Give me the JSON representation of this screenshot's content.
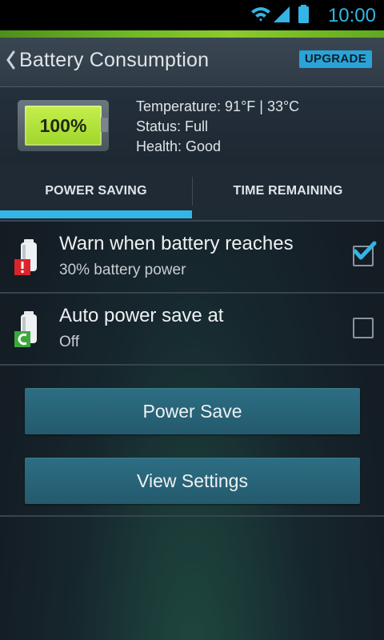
{
  "status_bar": {
    "time": "10:00",
    "icons": [
      "wifi-icon",
      "signal-icon",
      "battery-icon"
    ],
    "time_color": "#33b5e5"
  },
  "header": {
    "title": "Battery Consumption",
    "upgrade_label": "UPGRADE",
    "accent_color": "#29a3d8"
  },
  "battery": {
    "percent_label": "100%",
    "level": 1.0,
    "fill_color": "#b4e43a",
    "temperature_line": "Temperature: 91°F | 33°C",
    "status_line": "Status: Full",
    "health_line": "Health: Good"
  },
  "tabs": [
    {
      "label": "POWER SAVING",
      "selected": true
    },
    {
      "label": "TIME REMAINING",
      "selected": false
    }
  ],
  "settings": [
    {
      "title": "Warn when battery reaches",
      "subtitle": "30% battery power",
      "checked": true,
      "badge": "!",
      "badge_color": "#d9242a"
    },
    {
      "title": "Auto power save at",
      "subtitle": "Off",
      "checked": false,
      "badge": "C",
      "badge_color": "#3aa93b"
    }
  ],
  "buttons": {
    "power_save": "Power Save",
    "view_settings": "View Settings"
  }
}
